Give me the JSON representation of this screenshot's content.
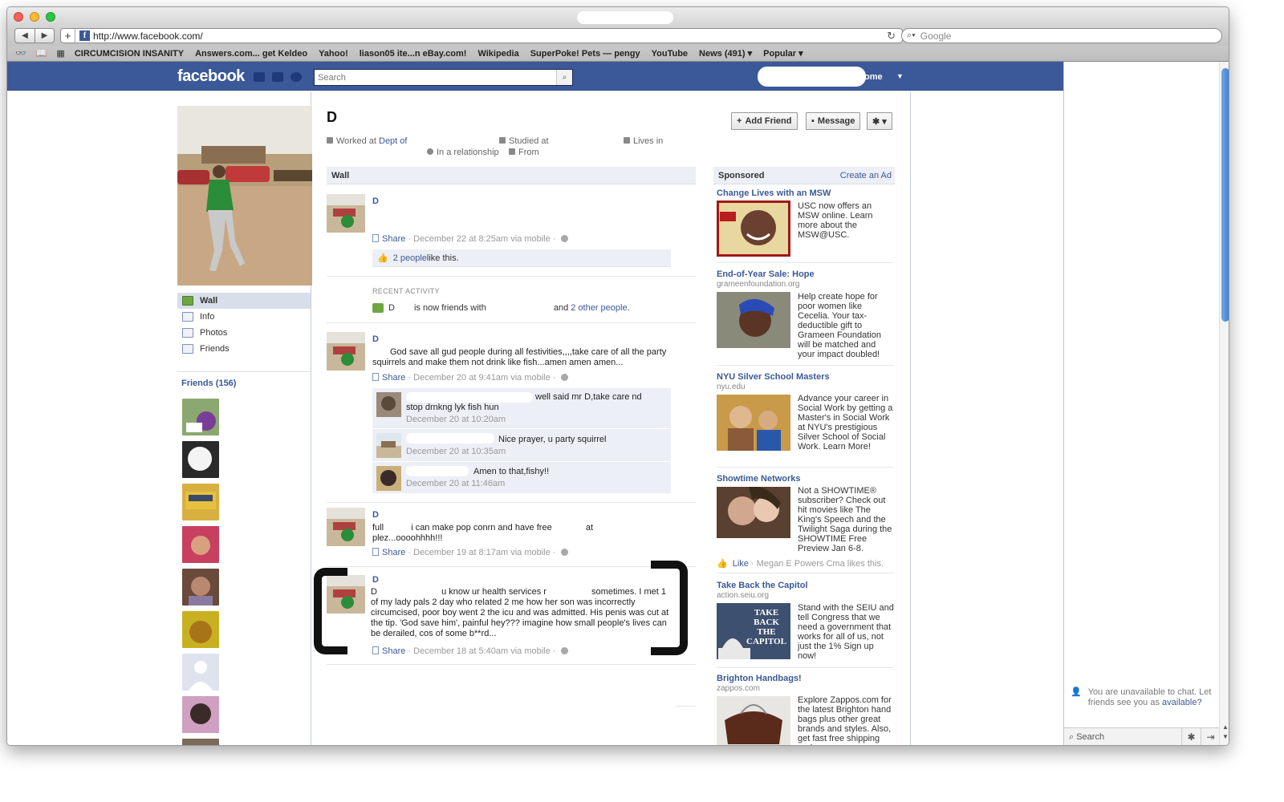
{
  "browser": {
    "url": "http://www.facebook.com/",
    "search_placeholder": "Google",
    "bookmarks": [
      "CIRCUMCISION INSANITY",
      "Answers.com... get Keldeo",
      "Yahoo!",
      "liason05 ite...n eBay.com!",
      "Wikipedia",
      "SuperPoke! Pets — pengy",
      "YouTube",
      "News (491) ▾",
      "Popular ▾"
    ]
  },
  "fb_header": {
    "logo": "facebook",
    "search_placeholder": "Search",
    "home_label": "ome"
  },
  "profile": {
    "name": "D",
    "worked_at": "Worked at",
    "worked_link": "Dept of",
    "studied_at": "Studied at",
    "lives_in": "Lives in",
    "relationship": "In a relationship",
    "from": "From",
    "buttons": {
      "add_friend": "Add Friend",
      "message": "Message",
      "gear": "✱ ▾"
    }
  },
  "left_nav": {
    "items": [
      "Wall",
      "Info",
      "Photos",
      "Friends"
    ],
    "friends_header": "Friends (156)"
  },
  "wall": {
    "header": "Wall",
    "posts": [
      {
        "author": "D",
        "share": "Share",
        "meta": " · December 22 at 8:25am via mobile · ",
        "likes_link": "2 people",
        "likes_suffix": " like this."
      },
      {
        "author": "D",
        "text": "God save all gud people          during all festivities,,,,take care of all the party squirrels and make them not drink like fish...amen amen amen...",
        "share": "Share",
        "meta": " · December 20 at 9:41am via mobile · ",
        "comments": [
          {
            "text_1": "well said mr D,take care nd",
            "text_2": "stop drnkng lyk fish hun",
            "time": "December 20 at 10:20am"
          },
          {
            "text_1": "Nice prayer, u party squirrel",
            "time": "December 20 at 10:35am"
          },
          {
            "text_1": "Amen to that,fishy!!",
            "time": "December 20 at 11:46am"
          }
        ]
      },
      {
        "author": "D",
        "text_full": "full",
        "text_mid": "i can make pop conrn  and have free",
        "text_at": "at",
        "text_2": "plez...oooohhhh!!!",
        "share": "Share",
        "meta": " · December 19 at 8:17am via mobile · "
      },
      {
        "author": "D",
        "text_start": "D",
        "text_a": "u know ur health services r",
        "text_b": "sometimes. I met 1",
        "text_rest": "of my lady pals 2 day who related 2 me how her son was incorrectly circumcised, poor boy went 2 the icu and was admitted. His penis was cut at the tip. 'God save him', painful hey??? imagine how small people's lives can be derailed, cos of some b**rd...",
        "share": "Share",
        "meta": " · December 18 at 5:40am via mobile · "
      }
    ],
    "recent_activity": {
      "header": "RECENT ACTIVITY",
      "name": "D",
      "text": "is now friends with",
      "and": "and",
      "others_link": "2 other people",
      "period": "."
    }
  },
  "sponsored": {
    "header": "Sponsored",
    "create_ad": "Create an Ad",
    "ads": [
      {
        "title": "Change Lives with an MSW",
        "body": "USC now offers an MSW online. Learn more about the MSW@USC."
      },
      {
        "title": "End-of-Year Sale: Hope",
        "domain": "grameenfoundation.org",
        "body": "Help create hope for poor women like Cecelia. Your tax-deductible gift to Grameen Foundation will be matched and your impact doubled!"
      },
      {
        "title": "NYU Silver School Masters",
        "domain": "nyu.edu",
        "body": "Advance your career in Social Work by getting a Master's in Social Work at NYU's prestigious Silver School of Social Work. Learn More!"
      },
      {
        "title": "Showtime Networks",
        "body": "Not a SHOWTIME® subscriber? Check out hit movies like The King's Speech and the Twilight Saga during the SHOWTIME Free Preview Jan 6-8.",
        "like": "Like",
        "like_text": " · Megan E Powers Cma likes this."
      },
      {
        "title": "Take Back the Capitol",
        "domain": "action.seiu.org",
        "body": "Stand with the SEIU and tell Congress that we need a government that works for all of us, not just the 1% Sign up now!",
        "img_text": "TAKE BACK THE CAPITOL"
      },
      {
        "title": "Brighton Handbags!",
        "domain": "zappos.com",
        "body": "Explore Zappos.com for the latest Brighton hand bags plus other great brands and styles. Also, get fast free shipping and"
      }
    ]
  },
  "chat": {
    "msg_1": "You are unavailable to chat. Let friends see you as",
    "available": "available?",
    "search": "Search"
  },
  "colors": {
    "fb_blue": "#3b5998",
    "link": "#3b5998",
    "panel": "#eceff5"
  }
}
